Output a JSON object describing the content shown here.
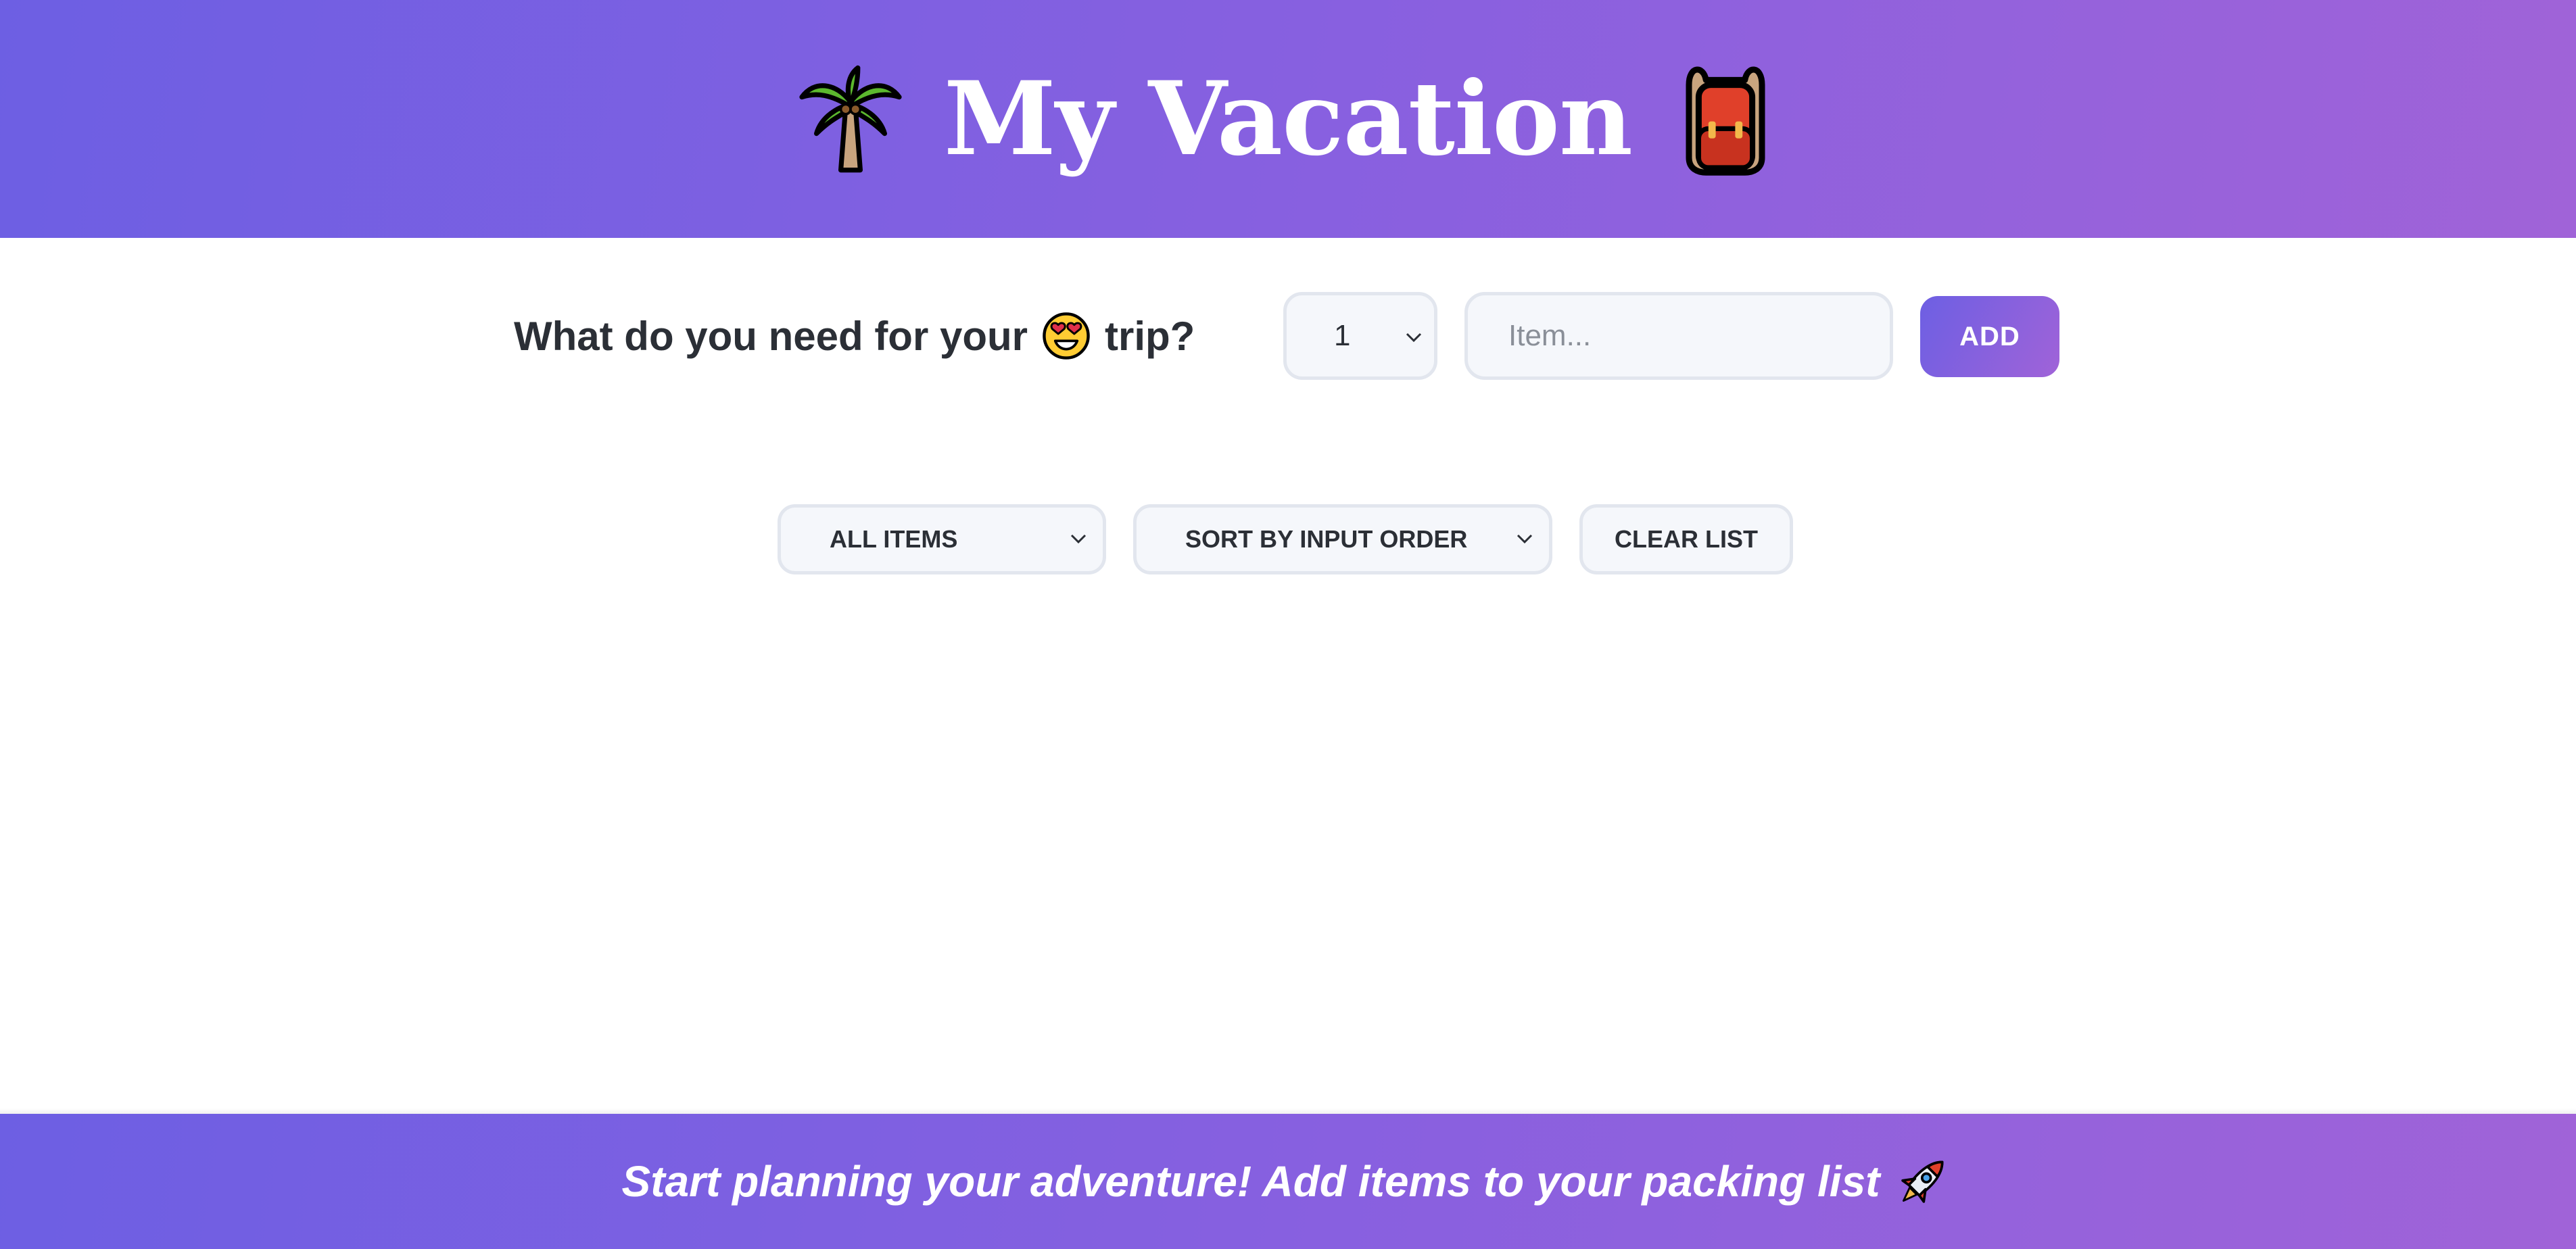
{
  "header": {
    "title": "My Vacation",
    "left_icon": "palm-tree-icon",
    "right_icon": "backpack-icon",
    "gradient": [
      "#6d5fe3",
      "#a063d8"
    ]
  },
  "form": {
    "question": "What do you need for your",
    "question_emoji": "heart-eyes-face-icon",
    "question_suffix": "trip?",
    "quantity_value": "1",
    "item_placeholder": "Item...",
    "add_label": "ADD"
  },
  "controls": {
    "filter_value": "ALL ITEMS",
    "sort_value": "SORT BY INPUT ORDER",
    "clear_label": "CLEAR LIST"
  },
  "items": [],
  "footer": {
    "message": "Start planning your adventure! Add items to your packing list",
    "icon": "rocket-icon"
  }
}
